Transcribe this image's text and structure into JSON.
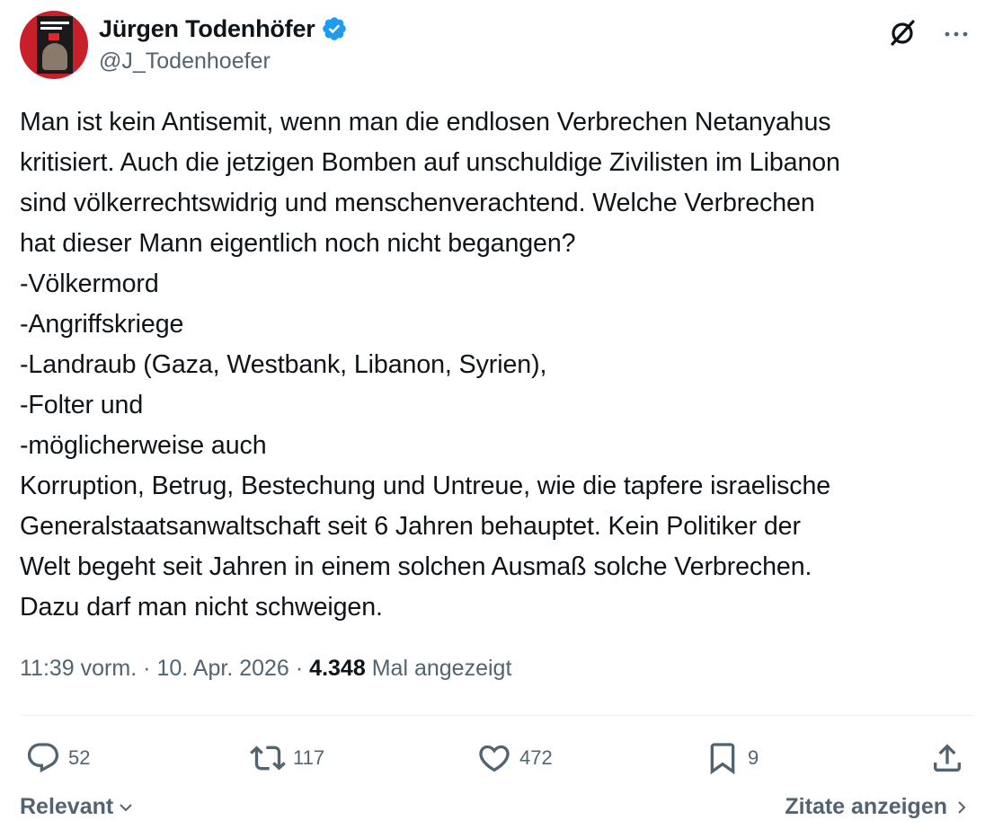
{
  "author": {
    "display_name": "Jürgen Todenhöfer",
    "handle": "@J_Todenhoefer",
    "verified_icon": "verified-badge-icon",
    "verified_color": "#1d9bf0",
    "avatar_book_text": "JÜRGEN TODENHÖFER"
  },
  "header_icons": {
    "grok": "grok-icon",
    "more": "more-icon"
  },
  "tweet": {
    "text": "Man ist kein Antisemit, wenn man die endlosen Verbrechen Netanyahus\nkritisiert. Auch die jetzigen Bomben auf unschuldige Zivilisten im Libanon\nsind völkerrechtswidrig und menschenverachtend. Welche Verbrechen\nhat dieser Mann eigentlich noch nicht begangen?\n-Völkermord\n-Angriffskriege\n-Landraub (Gaza, Westbank, Libanon, Syrien),\n-Folter und\n-möglicherweise auch\nKorruption, Betrug, Bestechung und Untreue, wie die tapfere israelische\nGeneralstaatsanwaltschaft seit 6 Jahren behauptet. Kein Politiker der\nWelt begeht seit Jahren in einem solchen Ausmaß solche Verbrechen.\nDazu darf man nicht schweigen."
  },
  "meta": {
    "time": "11:39 vorm.",
    "sep1": "·",
    "date": "10. Apr. 2026",
    "sep2": "·",
    "views": "4.348",
    "views_label": "Mal angezeigt"
  },
  "actions": {
    "replies": "52",
    "retweets": "117",
    "likes": "472",
    "bookmarks": "9"
  },
  "footer": {
    "sort_label": "Relevant",
    "quotes_label": "Zitate anzeigen"
  },
  "colors": {
    "text": "#0f1419",
    "secondary": "#536471",
    "divider": "#eff3f4",
    "accent": "#1d9bf0"
  }
}
